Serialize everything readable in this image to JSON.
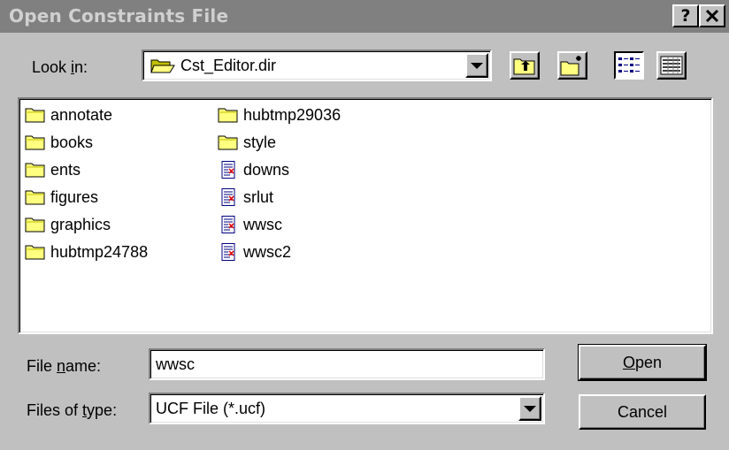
{
  "dialog": {
    "title": "Open Constraints File",
    "help_button": "?",
    "close_button": "×"
  },
  "look_in": {
    "label_prefix": "Look ",
    "label_hotkey": "i",
    "label_suffix": "n:",
    "value": "Cst_Editor.dir"
  },
  "toolbar": {
    "up_folder": "up-one-level-icon",
    "new_folder": "create-new-folder-icon",
    "list_view": "list-view-icon",
    "details_view": "details-view-icon"
  },
  "files": {
    "column1": [
      {
        "name": "annotate",
        "type": "folder"
      },
      {
        "name": "books",
        "type": "folder"
      },
      {
        "name": "ents",
        "type": "folder"
      },
      {
        "name": "figures",
        "type": "folder"
      },
      {
        "name": "graphics",
        "type": "folder"
      },
      {
        "name": "hubtmp24788",
        "type": "folder"
      }
    ],
    "column2": [
      {
        "name": "hubtmp29036",
        "type": "folder"
      },
      {
        "name": "style",
        "type": "folder"
      },
      {
        "name": "downs",
        "type": "file"
      },
      {
        "name": "srlut",
        "type": "file"
      },
      {
        "name": "wwsc",
        "type": "file"
      },
      {
        "name": "wwsc2",
        "type": "file"
      }
    ]
  },
  "file_name": {
    "label_prefix": "File ",
    "label_hotkey": "n",
    "label_suffix": "ame:",
    "value": "wwsc"
  },
  "file_type": {
    "label_prefix": "Files of ",
    "label_hotkey": "t",
    "label_suffix": "ype:",
    "value": "UCF File (*.ucf)"
  },
  "buttons": {
    "open_hotkey": "O",
    "open_rest": "pen",
    "cancel": "Cancel"
  }
}
